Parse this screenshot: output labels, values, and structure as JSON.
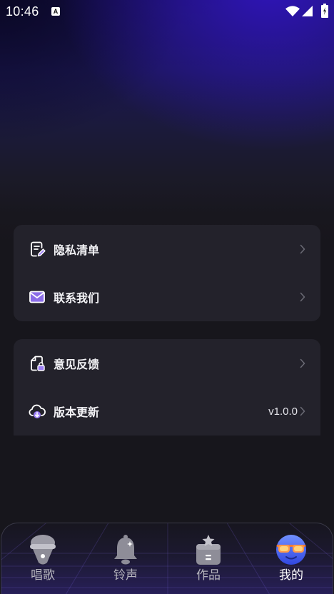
{
  "status_bar": {
    "time": "10:46",
    "notification_glyph": "A",
    "icons": [
      "wifi-icon",
      "signal-icon",
      "battery-charging-icon"
    ]
  },
  "menu_groups": [
    {
      "items": [
        {
          "label": "隐私清单",
          "icon": "privacy-list-icon"
        },
        {
          "label": "联系我们",
          "icon": "mail-icon"
        }
      ]
    },
    {
      "items": [
        {
          "label": "意见反馈",
          "icon": "feedback-icon"
        },
        {
          "label": "版本更新",
          "icon": "cloud-download-icon",
          "value": "v1.0.0"
        }
      ]
    }
  ],
  "tab_bar": {
    "tabs": [
      {
        "label": "唱歌",
        "icon": "microphone-icon",
        "active": false
      },
      {
        "label": "铃声",
        "icon": "bell-icon",
        "active": false
      },
      {
        "label": "作品",
        "icon": "works-box-icon",
        "active": false
      },
      {
        "label": "我的",
        "icon": "profile-face-icon",
        "active": true
      }
    ]
  },
  "colors": {
    "background": "#17161c",
    "header_glow": "#3416cd",
    "card": "#23222b",
    "accent": "#9b7df5",
    "text_primary": "#ffffff",
    "text_inactive": "#b4b3bc",
    "chevron": "#6b6b75"
  }
}
